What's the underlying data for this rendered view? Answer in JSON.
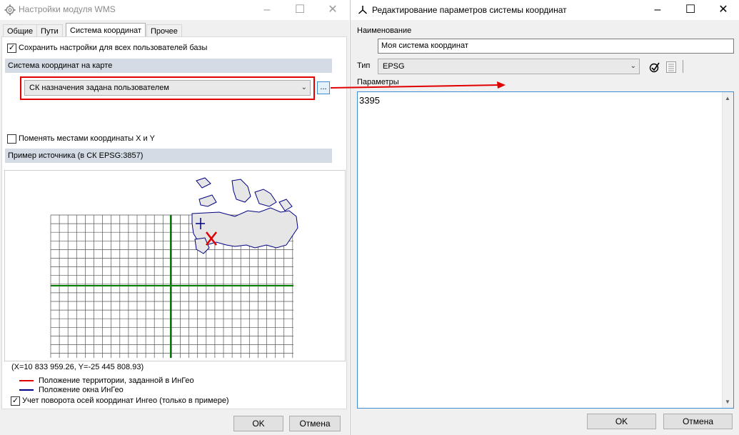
{
  "win1": {
    "title": "Настройки модуля WMS",
    "tabs": [
      "Общие",
      "Пути",
      "Система координат",
      "Прочее"
    ],
    "save_all_label": "Сохранить настройки для всех пользователей базы",
    "map_cs_section": "Система координат на карте",
    "cs_combo_value": "СК назначения задана пользователем",
    "ellipsis_label": "...",
    "swap_xy_label": "Поменять местами координаты X и Y",
    "example_section": "Пример источника (в СК EPSG:3857)",
    "coords_readout": "(X=10 833 959.26, Y=-25 445 808.93)",
    "legend_red": "Положение территории, заданной в ИнГео",
    "legend_blue": "Положение окна ИнГео",
    "rotation_label": "Учет поворота осей координат Ингео (только в примере)",
    "ok": "OK",
    "cancel": "Отмена"
  },
  "win2": {
    "title": "Редактирование параметров системы координат",
    "name_label": "Наименование",
    "name_value": "Моя система координат",
    "type_label": "Тип",
    "type_value": "EPSG",
    "params_label": "Параметры",
    "params_value": "3395",
    "ok": "OK",
    "cancel": "Отмена"
  },
  "colors": {
    "highlight_red": "#e00000",
    "grid_green": "#008000",
    "map_blue": "#000080",
    "section_bg": "#d4dbe4"
  },
  "icons": [
    "gear-icon",
    "minimize-icon",
    "maximize-icon",
    "close-icon",
    "app-icon",
    "check-circle-icon",
    "list-icon",
    "chevron-down-icon"
  ]
}
